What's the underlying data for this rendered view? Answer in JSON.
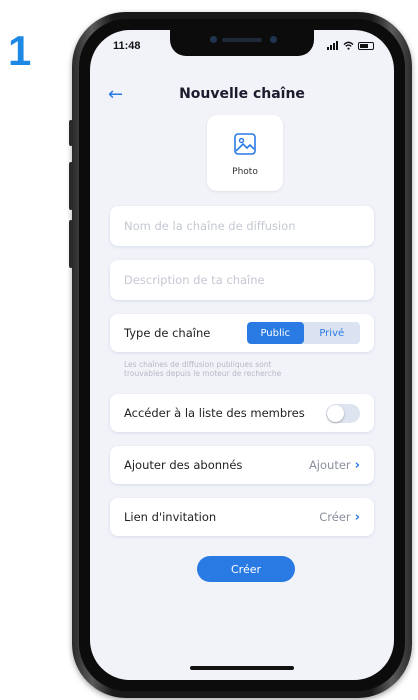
{
  "step_number": "1",
  "status_bar": {
    "time": "11:48"
  },
  "header": {
    "back_icon": "arrow-left-icon",
    "title": "Nouvelle chaîne"
  },
  "photo": {
    "icon": "image-icon",
    "label": "Photo"
  },
  "form": {
    "name_placeholder": "Nom de la chaîne de diffusion",
    "description_placeholder": "Description de ta chaîne"
  },
  "channel_type": {
    "label": "Type de chaîne",
    "options": [
      "Public",
      "Privé"
    ],
    "selected": "Public",
    "hint_line1": "Les chaînes de diffusion publiques sont",
    "hint_line2": "trouvables depuis le moteur de recherche"
  },
  "members_access": {
    "label": "Accéder à la liste des membres",
    "enabled": false
  },
  "subscribers": {
    "label": "Ajouter des abonnés",
    "action": "Ajouter"
  },
  "invite_link": {
    "label": "Lien d'invitation",
    "action": "Créer"
  },
  "submit_label": "Créer",
  "colors": {
    "accent": "#2a7ae4",
    "background": "#f2f3f9",
    "step_number": "#1e88e5"
  }
}
